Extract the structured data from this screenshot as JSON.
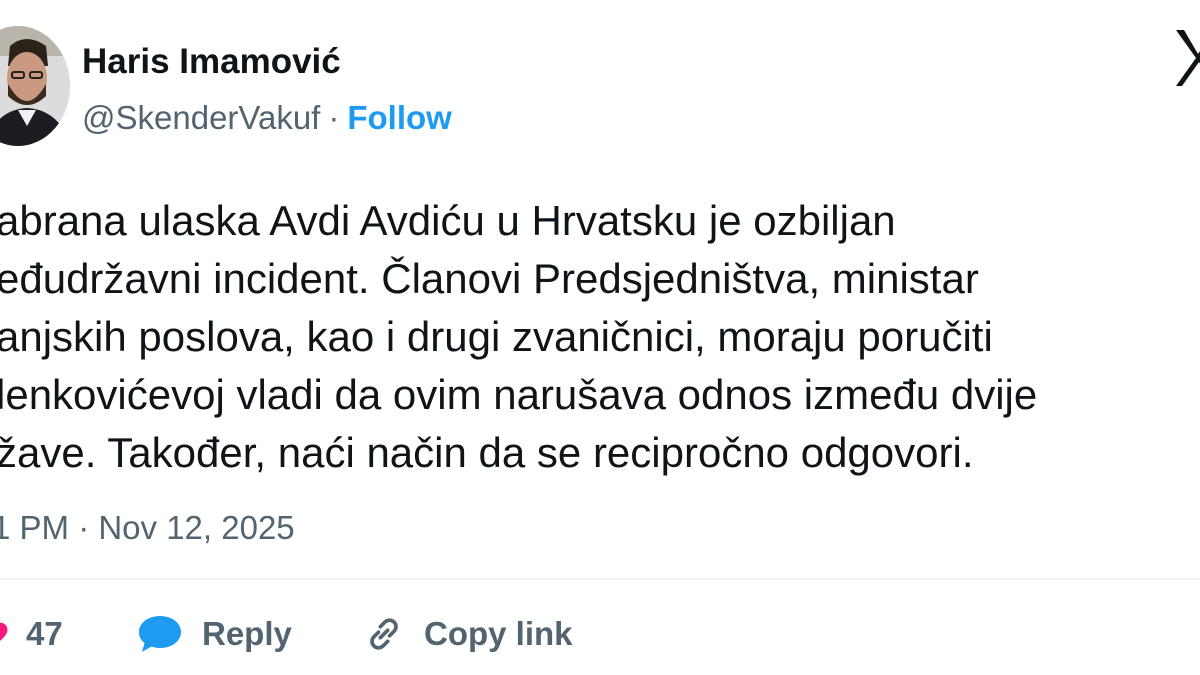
{
  "author": {
    "name": "Haris Imamović",
    "handle": "@SkenderVakuf",
    "separator": "·",
    "follow_label": "Follow"
  },
  "tweet": {
    "lines": [
      "abrana ulaska Avdi Avdiću u Hrvatsku je ozbiljan",
      "eđudržavni incident. Članovi Predsjedništva, ministar",
      "anjskih poslova, kao i drugi zvaničnici, moraju poručiti",
      "lenkovićevoj vladi da ovim narušava odnos između dvije",
      "žave. Također, naći način da se recipročno odgovori."
    ],
    "timestamp": "1 PM · Nov 12, 2025"
  },
  "actions": {
    "like_count": "47",
    "reply_label": "Reply",
    "copy_link_label": "Copy link"
  },
  "colors": {
    "accent": "#1d9bf0",
    "text_primary": "#0f1419",
    "text_secondary": "#536471",
    "like_red": "#f91880",
    "divider": "#eff3f4"
  },
  "icons": {
    "platform_logo": "x-logo-icon",
    "like": "heart-icon",
    "reply": "speech-bubble-icon",
    "copy_link": "chain-link-icon"
  }
}
